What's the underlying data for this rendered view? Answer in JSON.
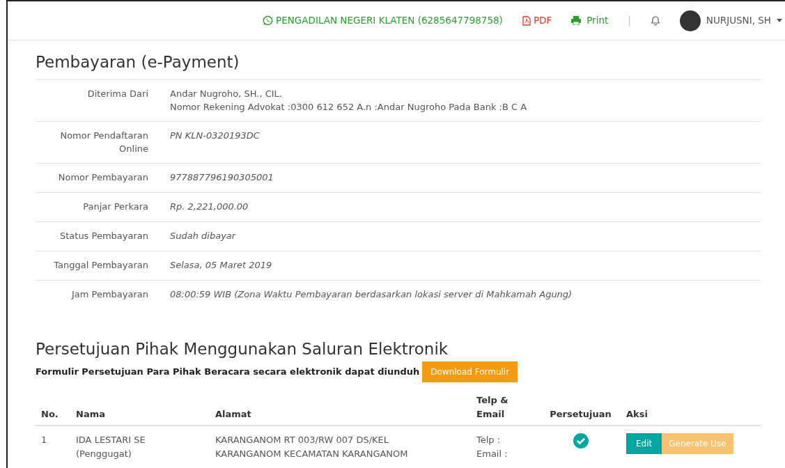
{
  "topbar": {
    "court": "PENGADILAN NEGERI KLATEN (6285647798758)",
    "pdf": "PDF",
    "print": "Print",
    "separator": "|",
    "user": "NURJUSNI, SH"
  },
  "payment": {
    "title": "Pembayaran (e-Payment)",
    "rows": [
      {
        "label": "Diterima Dari",
        "kind": "plain",
        "lines": [
          "Andar Nugroho, SH., CIL.",
          "Nomor Rekening Advokat :0300 612 652 A.n :Andar Nugroho Pada Bank :B C A"
        ]
      },
      {
        "label": "Nomor Pendaftaran Online",
        "kind": "italic",
        "lines": [
          "PN KLN-0320193DC"
        ]
      },
      {
        "label": "Nomor Pembayaran",
        "kind": "italic",
        "lines": [
          "977887796190305001"
        ]
      },
      {
        "label": "Panjar Perkara",
        "kind": "italic",
        "lines": [
          "Rp. 2,221,000.00"
        ]
      },
      {
        "label": "Status Pembayaran",
        "kind": "italic",
        "lines": [
          "Sudah dibayar"
        ]
      },
      {
        "label": "Tanggal Pembayaran",
        "kind": "italic",
        "lines": [
          "Selasa, 05 Maret 2019"
        ]
      },
      {
        "label": "Jam Pembayaran",
        "kind": "italic",
        "lines": [
          "08:00:59 WIB (Zona Waktu Pembayaran berdasarkan lokasi server di Mahkamah Agung)"
        ]
      }
    ]
  },
  "consent": {
    "title": "Persetujuan Pihak Menggunakan Saluran Elektronik",
    "note": "Formulir Persetujuan Para Pihak Beracara secara elektronik dapat diunduh",
    "download_button": "Download Formulir",
    "table": {
      "columns": [
        "No.",
        "Nama",
        "Alamat",
        "Telp & Email",
        "Persetujuan",
        "Aksi"
      ],
      "rows": [
        {
          "no": "1",
          "nama": [
            "IDA LESTARI SE",
            "(Penggugat)"
          ],
          "alamat": [
            "KARANGANOM RT 003/RW 007 DS/KEL",
            "KARANGANOM KECAMATAN KARANGANOM"
          ],
          "kontak": [
            "Telp :",
            "Email :"
          ],
          "approved": true,
          "actions": [
            "Edit",
            "Generate Use"
          ]
        }
      ]
    }
  }
}
